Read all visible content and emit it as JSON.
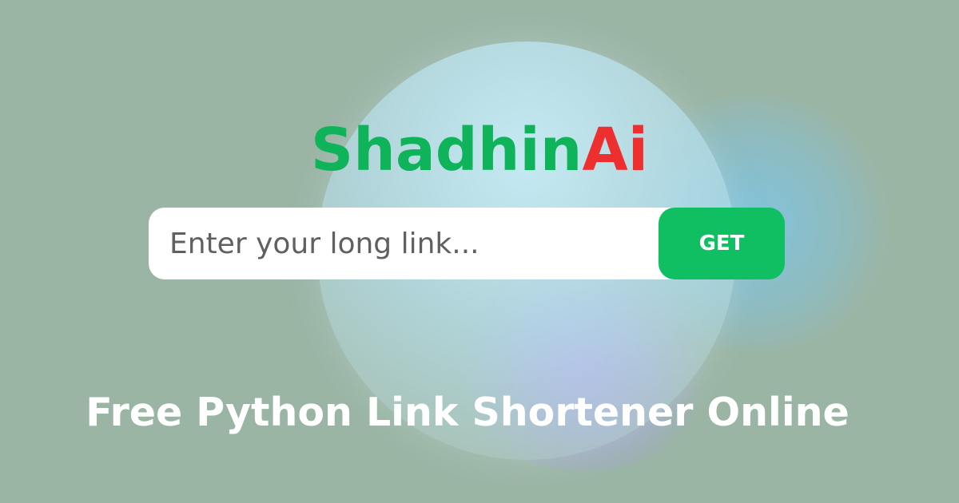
{
  "brand": {
    "name_main": "Shadhin",
    "name_accent": "Ai",
    "main_color": "#0fb45a",
    "accent_color": "#ee2f2f"
  },
  "search": {
    "placeholder": "Enter your long link...",
    "value": ""
  },
  "get_button": {
    "label": "GET",
    "color": "#0fbf62"
  },
  "tagline": "Free Python Link Shortener Online",
  "colors": {
    "background": "#9bb5a5",
    "glow_blue": "#78c8f0",
    "glow_purple": "#af96f5"
  }
}
